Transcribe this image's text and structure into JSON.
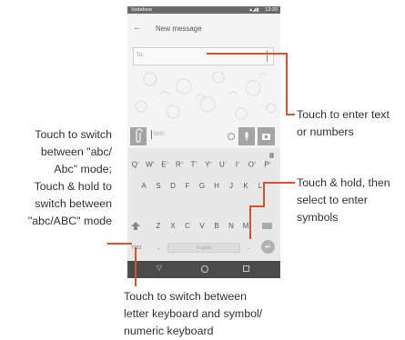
{
  "status_bar": {
    "carrier": "Vodafone",
    "time": "13:20",
    "signal": "▲◢ ▮"
  },
  "app_bar": {
    "title": "New message"
  },
  "recipient": {
    "placeholder": "To:"
  },
  "compose": {
    "placeholder": "SMS"
  },
  "keyboard": {
    "row1": [
      {
        "key": "Q",
        "hint": "1"
      },
      {
        "key": "W",
        "hint": "2"
      },
      {
        "key": "E",
        "hint": "3"
      },
      {
        "key": "R",
        "hint": "4"
      },
      {
        "key": "T",
        "hint": "5"
      },
      {
        "key": "Y",
        "hint": "6"
      },
      {
        "key": "U",
        "hint": "7"
      },
      {
        "key": "I",
        "hint": "8"
      },
      {
        "key": "O",
        "hint": "9"
      },
      {
        "key": "P",
        "hint": "0"
      }
    ],
    "row2": [
      "A",
      "S",
      "D",
      "F",
      "G",
      "H",
      "J",
      "K",
      "L"
    ],
    "row3": [
      "Z",
      "X",
      "C",
      "V",
      "B",
      "N",
      "M"
    ],
    "symbols_key": "?123",
    "comma_key": ",",
    "space_label": "English",
    "period_key": "."
  },
  "callouts": {
    "enter_text": [
      "Touch to enter text",
      "or numbers"
    ],
    "caps_mode": [
      "Touch to switch",
      "between \"abc/",
      "Abc\" mode;",
      "Touch & hold to",
      "switch between",
      "\"abc/ABC\" mode"
    ],
    "long_press": [
      "Touch & hold, then",
      "select to enter",
      "symbols"
    ],
    "symbols_switch": [
      "Touch to switch between",
      "letter keyboard and symbol/",
      "numeric keyboard"
    ]
  },
  "colors": {
    "leader_line": "#d9532a",
    "nav_bar": "#4b4b4b",
    "status_bar": "#6a6a6a"
  }
}
